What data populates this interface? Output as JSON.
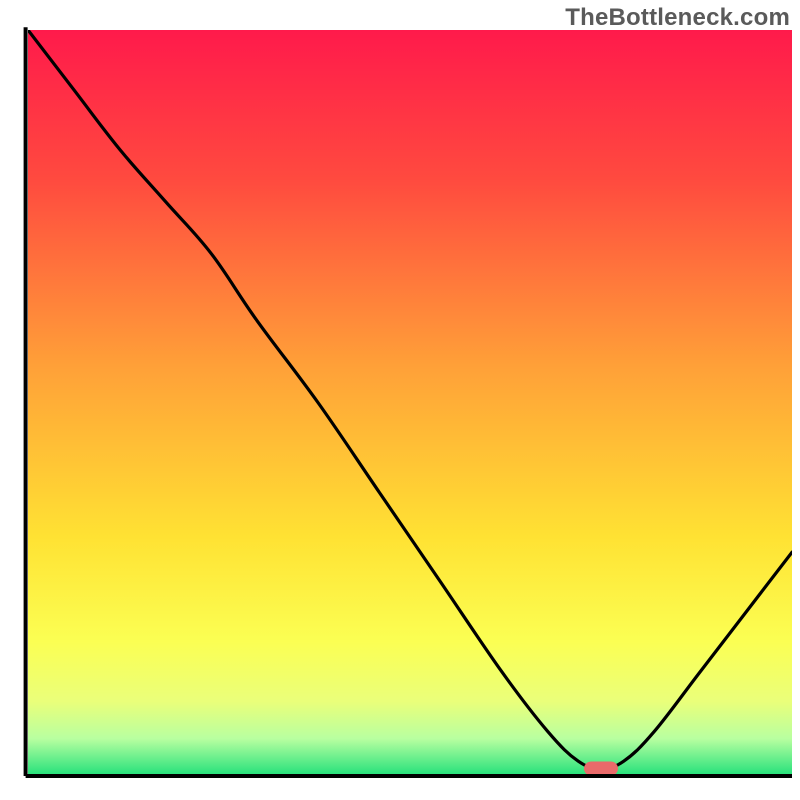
{
  "watermark": "TheBottleneck.com",
  "chart_data": {
    "type": "line",
    "title": "",
    "xlabel": "",
    "ylabel": "",
    "xlim": [
      0,
      100
    ],
    "ylim": [
      0,
      100
    ],
    "gradient_stops": [
      {
        "offset": 0.0,
        "color": "#ff1a4b"
      },
      {
        "offset": 0.2,
        "color": "#ff4a3f"
      },
      {
        "offset": 0.45,
        "color": "#ffa038"
      },
      {
        "offset": 0.68,
        "color": "#ffe233"
      },
      {
        "offset": 0.82,
        "color": "#fbff53"
      },
      {
        "offset": 0.9,
        "color": "#eaff7a"
      },
      {
        "offset": 0.95,
        "color": "#b8ffa0"
      },
      {
        "offset": 1.0,
        "color": "#22e07a"
      }
    ],
    "series": [
      {
        "name": "bottleneck-curve",
        "x": [
          0,
          6,
          12,
          18,
          24,
          30,
          38,
          46,
          54,
          62,
          68,
          72,
          75,
          78,
          82,
          88,
          94,
          100
        ],
        "values": [
          100,
          92,
          84,
          77,
          70,
          61,
          50,
          38,
          26,
          14,
          6,
          2,
          1,
          2,
          6,
          14,
          22,
          30
        ]
      }
    ],
    "marker": {
      "x": 75,
      "y": 1,
      "color": "#e96a6a",
      "rx": 8
    },
    "axis": {
      "left": {
        "x0": 3.2,
        "y0": 3.4,
        "x1": 3.2,
        "y1": 97.0
      },
      "bottom": {
        "x0": 3.2,
        "y0": 97.0,
        "x1": 99.0,
        "y1": 97.0
      }
    }
  }
}
